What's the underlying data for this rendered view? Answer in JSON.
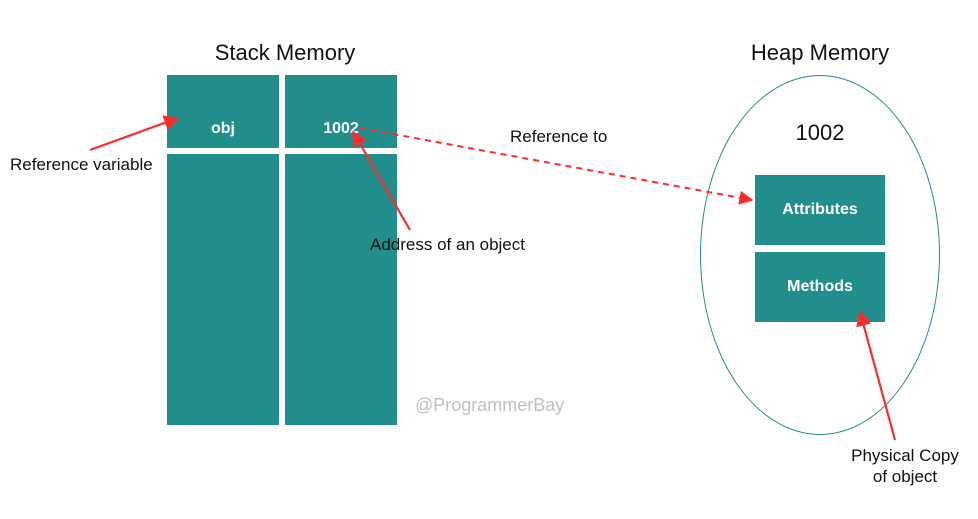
{
  "stack": {
    "title": "Stack Memory",
    "var_name": "obj",
    "address": "1002"
  },
  "heap": {
    "title": "Heap Memory",
    "address": "1002",
    "attributes_label": "Attributes",
    "methods_label": "Methods"
  },
  "labels": {
    "reference_variable": "Reference variable",
    "address_of_object": "Address of an object",
    "reference_to": "Reference to",
    "physical_copy_line1": "Physical Copy",
    "physical_copy_line2": "of object"
  },
  "watermark": "@ProgrammerBay",
  "colors": {
    "teal": "#218e8c",
    "arrow": "#ff2a2a"
  }
}
